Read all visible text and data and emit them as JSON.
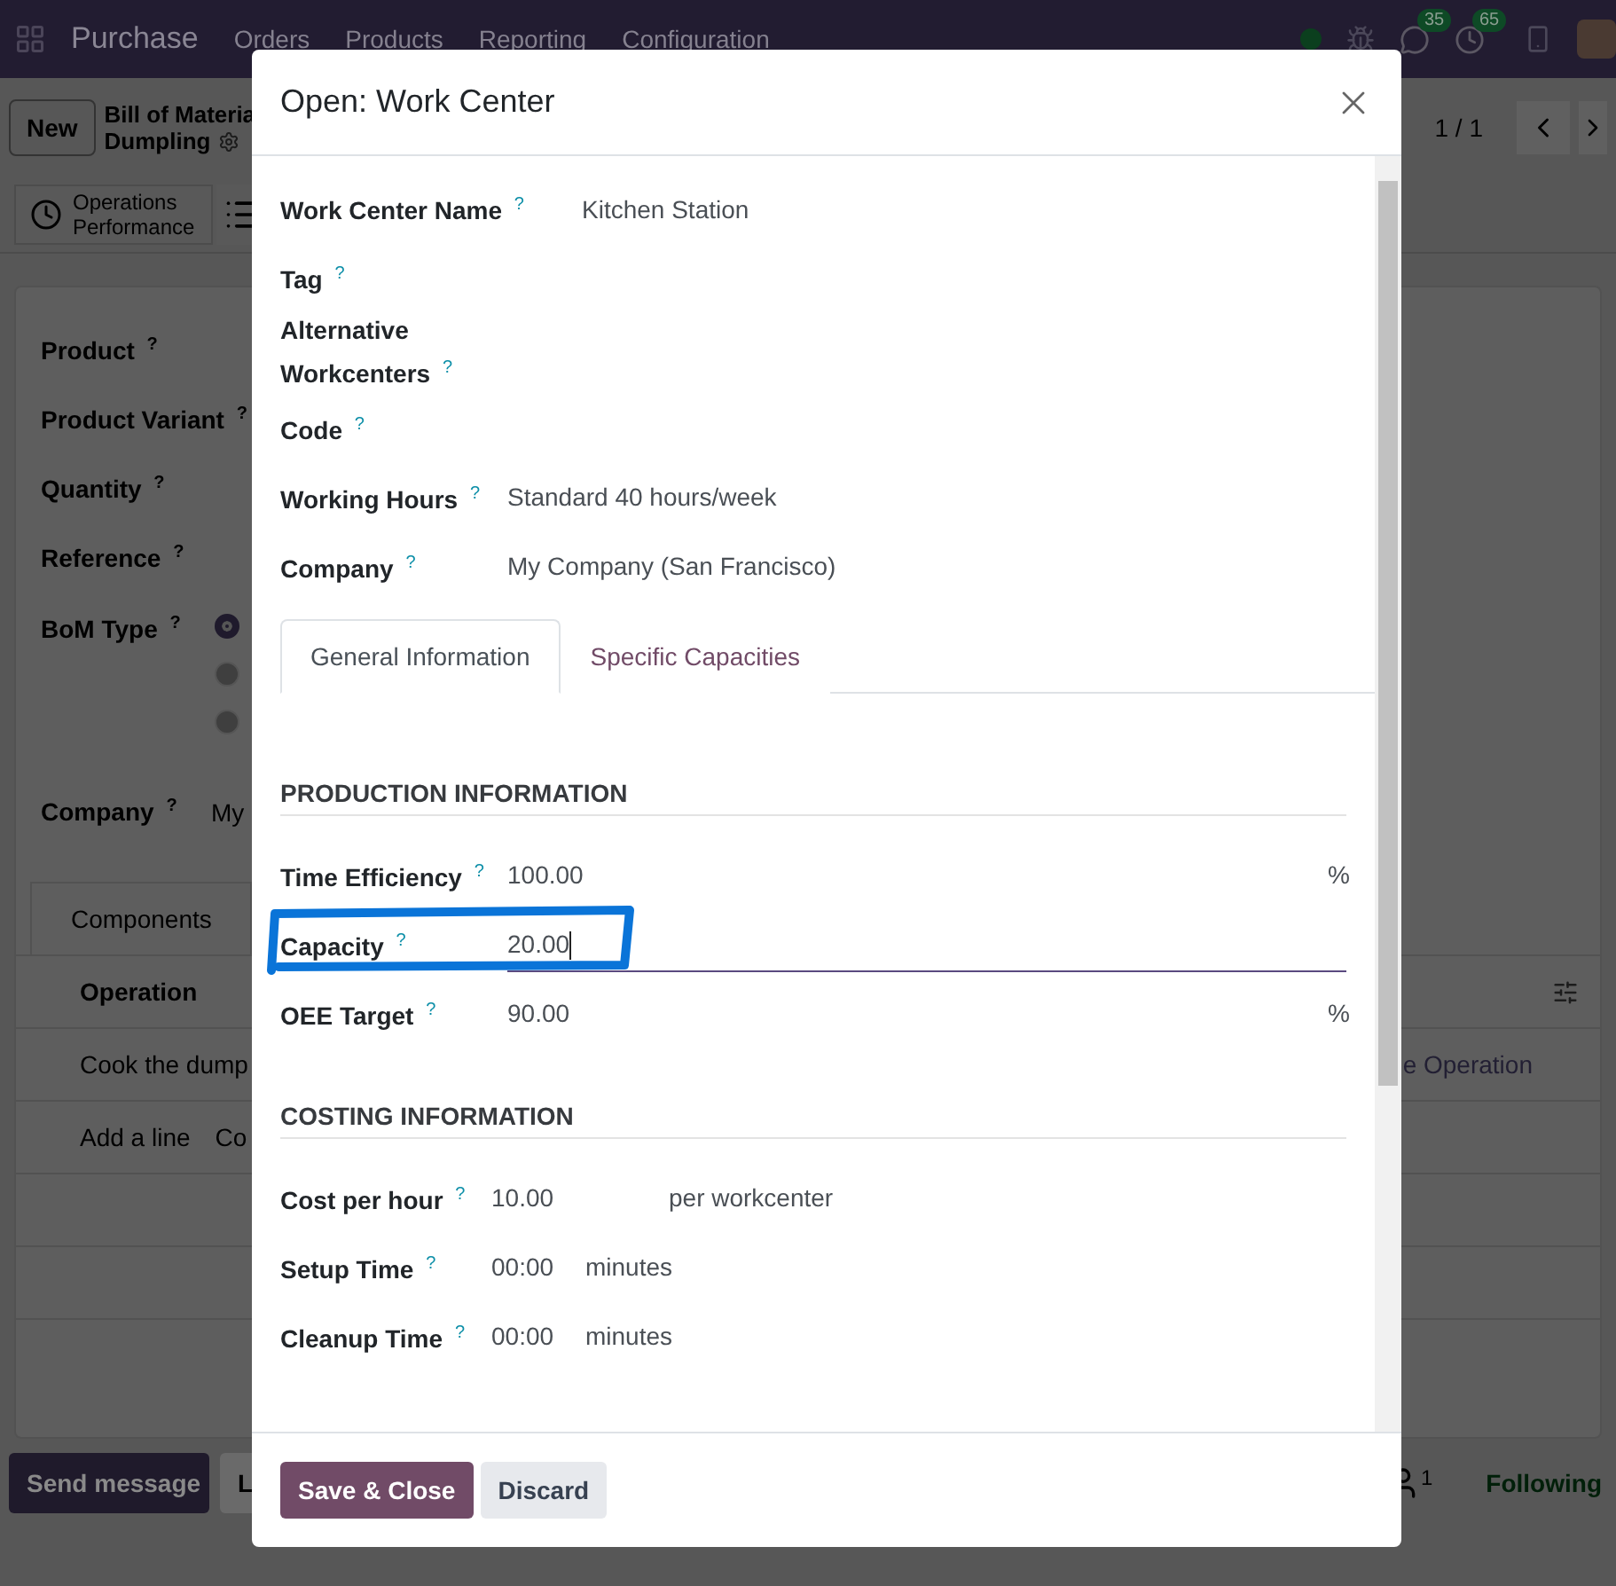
{
  "navbar": {
    "app": "Purchase",
    "menus": [
      "Orders",
      "Products",
      "Reporting",
      "Configuration"
    ],
    "badges": [
      {
        "kind": "chat",
        "count": "35"
      },
      {
        "kind": "activity",
        "count": "65"
      }
    ]
  },
  "control_panel": {
    "new_button": "New",
    "breadcrumb": "Bill of Materia",
    "record": "Dumpling",
    "pager": "1 / 1"
  },
  "smart_button": "Operations Performance",
  "form": {
    "fields": [
      {
        "label": "Product $^{?}$"
      },
      {
        "label": "Product Variant $^{?}$"
      },
      {
        "label": "Quantity $^{?}$"
      },
      {
        "label": "Reference $^{?}$"
      }
    ],
    "bom_type": {
      "label": "BoM Type $^{?}$",
      "options": [
        {
          "selected": true
        },
        {
          "selected": false
        },
        {
          "selected": false
        }
      ]
    },
    "company": {
      "label": "Company $^{?}$",
      "value": "My"
    }
  },
  "notebook": {
    "tab": "Components",
    "column": "Operation",
    "row": [
      "Cook the dump",
      "e Operation"
    ],
    "add_line": "Add a line",
    "add_line_2": "Co"
  },
  "chatter": {
    "buttons": [
      "Send message",
      "L"
    ],
    "followers": "1",
    "follow_state": "Following"
  },
  "dialog": {
    "title": "Open: Work Center",
    "fields": [
      {
        "label": "Work Center Name $^{?}$",
        "value": "Kitchen Station",
        "kind": "title"
      },
      {
        "label": "Tag $^{?}$",
        "kind": "plain"
      },
      {
        "label": "Alternative Workcenters $^{?}$",
        "kind": "plain"
      },
      {
        "label": "Code $^{?}$",
        "kind": "plain"
      },
      {
        "label": "Working Hours $^{?}$",
        "value": "Standard 40 hours/week",
        "kind": "plain"
      },
      {
        "label": "Company $^{?}$",
        "value": "My Company (San Francisco)",
        "kind": "plain"
      }
    ],
    "tabs": [
      {
        "label": "General Information",
        "selected": true
      },
      {
        "label": "Specific Capacities",
        "selected": false
      }
    ],
    "sections": [
      {
        "title": "PRODUCTION INFORMATION",
        "fields": [
          {
            "label": "Time Efficiency $^{?}$",
            "value": "100.00",
            "unit": "%",
            "kind": "percent",
            "focused": false
          },
          {
            "label": "Capacity $^{?}$",
            "value": "20.00",
            "kind": "plain",
            "focused": true
          },
          {
            "label": "OEE Target $^{?}$",
            "value": "90.00",
            "unit": "%",
            "kind": "percent",
            "focused": false
          }
        ]
      },
      {
        "title": "COSTING INFORMATION",
        "fields": [
          {
            "label": "Cost per hour $^{?}$",
            "value": "10.00",
            "unit": "per workcenter",
            "kind": "money",
            "focused": false
          },
          {
            "label": "Setup Time $^{?}$",
            "value": "00:00",
            "unit": "minutes",
            "kind": "duration",
            "focused": false
          },
          {
            "label": "Cleanup Time $^{?}$",
            "value": "00:00",
            "unit": "minutes",
            "kind": "duration",
            "focused": false
          }
        ]
      }
    ],
    "buttons": [
      {
        "label": "Save & Close",
        "kind": "primary"
      },
      {
        "label": "Discard",
        "kind": "secondary"
      }
    ]
  }
}
